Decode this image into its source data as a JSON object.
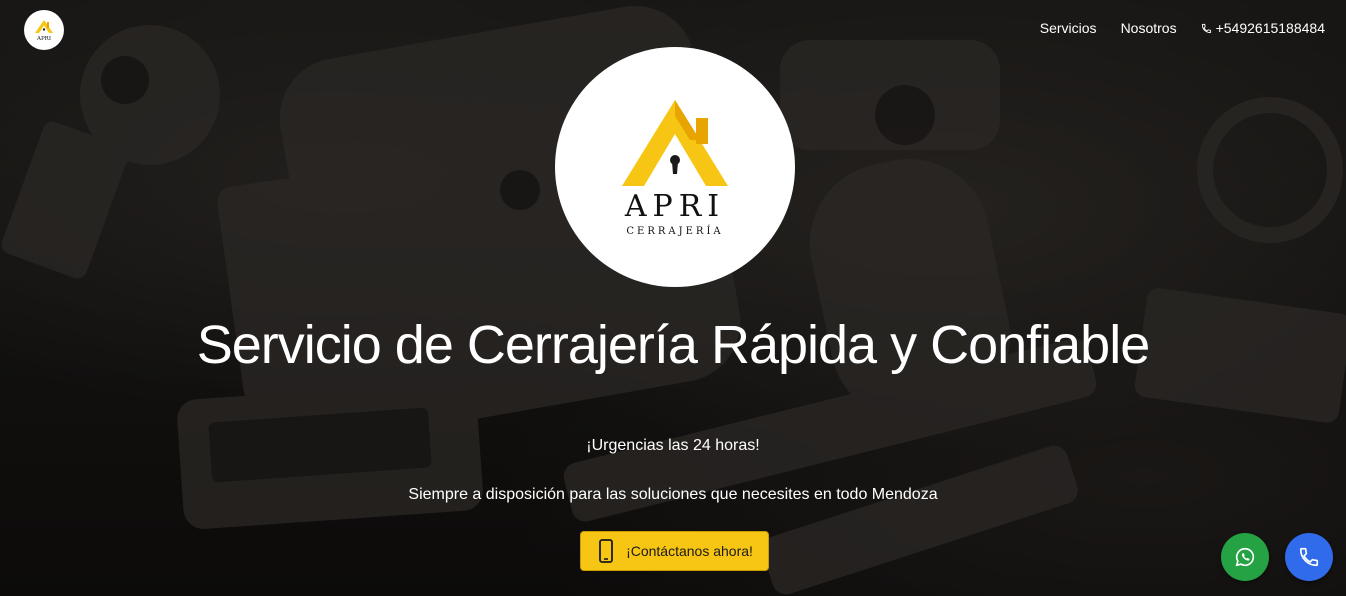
{
  "brand": {
    "name": "APRI",
    "subtitle": "CERRAJERÍA",
    "small_name": "APRI",
    "accent_color": "#f7c614",
    "accent_dark": "#e8a400"
  },
  "nav": {
    "items": [
      {
        "label": "Servicios"
      },
      {
        "label": "Nosotros"
      }
    ],
    "phone": "+5492615188484",
    "phone_icon": "phone-icon"
  },
  "hero": {
    "title": "Servicio de Cerrajería Rápida y Confiable",
    "urgent": "¡Urgencias las 24 horas!",
    "description": "Siempre a disposición para las soluciones que necesites en todo Mendoza",
    "cta_label": "¡Contáctanos ahora!",
    "cta_icon": "smartphone-icon",
    "cta_color": "#f7c614"
  },
  "floating": {
    "whatsapp_icon": "whatsapp-icon",
    "whatsapp_color": "#25a244",
    "call_icon": "phone-icon",
    "call_color": "#2f6bea"
  }
}
